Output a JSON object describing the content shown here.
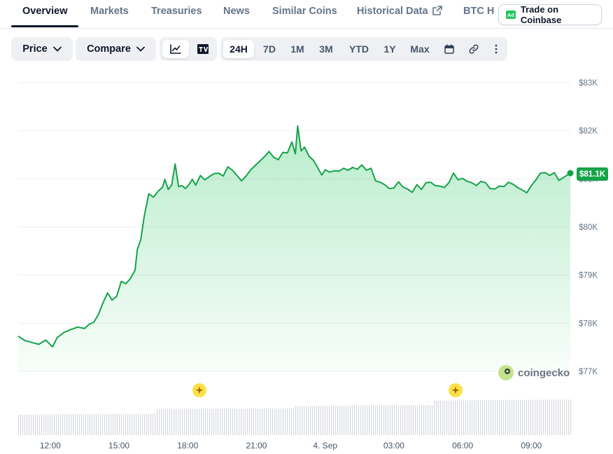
{
  "tabs": [
    {
      "label": "Overview",
      "active": true
    },
    {
      "label": "Markets"
    },
    {
      "label": "Treasuries"
    },
    {
      "label": "News"
    },
    {
      "label": "Similar Coins"
    },
    {
      "label": "Historical Data"
    },
    {
      "label": "BTC H"
    }
  ],
  "trade_button": {
    "badge": "Ad",
    "label": "Trade on Coinbase"
  },
  "toolbar": {
    "price_dropdown": "Price",
    "compare_dropdown": "Compare",
    "chart_modes": [
      "line-chart-icon",
      "tradingview-icon"
    ],
    "ranges": [
      "24H",
      "7D",
      "1M",
      "3M",
      "YTD",
      "1Y",
      "Max"
    ],
    "active_range": "24H",
    "tools": [
      "calendar-icon",
      "link-icon",
      "more-icon"
    ]
  },
  "price_badge": "$81.1K",
  "watermark": "coingecko",
  "colors": {
    "line": "#16a34a",
    "fill": "#22c55e",
    "volume": "#d1d5db",
    "marker": "#fde047"
  },
  "chart_data": {
    "type": "area",
    "y_ticks": [
      "$83K",
      "$82K",
      "$81K",
      "$80K",
      "$79K",
      "$78K",
      "$77K"
    ],
    "ylim": [
      77000,
      83000
    ],
    "x_ticks": [
      "12:00",
      "15:00",
      "18:00",
      "21:00",
      "4. Sep",
      "03:00",
      "06:00",
      "09:00"
    ],
    "x_range_hours": [
      -1.4,
      22.7
    ],
    "grid": true,
    "series": [
      {
        "values": [
          [
            -1.4,
            77730
          ],
          [
            -1.1,
            77640
          ],
          [
            -0.8,
            77600
          ],
          [
            -0.5,
            77560
          ],
          [
            -0.2,
            77650
          ],
          [
            0.1,
            77510
          ],
          [
            0.3,
            77700
          ],
          [
            0.6,
            77810
          ],
          [
            0.9,
            77870
          ],
          [
            1.2,
            77920
          ],
          [
            1.5,
            77890
          ],
          [
            1.7,
            77980
          ],
          [
            1.9,
            78020
          ],
          [
            2.1,
            78180
          ],
          [
            2.3,
            78420
          ],
          [
            2.5,
            78630
          ],
          [
            2.7,
            78480
          ],
          [
            2.9,
            78560
          ],
          [
            3.1,
            78870
          ],
          [
            3.3,
            78820
          ],
          [
            3.5,
            78930
          ],
          [
            3.7,
            79100
          ],
          [
            3.8,
            79530
          ],
          [
            3.95,
            79740
          ],
          [
            4.1,
            80220
          ],
          [
            4.3,
            80690
          ],
          [
            4.5,
            80620
          ],
          [
            4.7,
            80740
          ],
          [
            4.9,
            80830
          ],
          [
            5.0,
            80990
          ],
          [
            5.15,
            80780
          ],
          [
            5.3,
            80870
          ],
          [
            5.45,
            81310
          ],
          [
            5.6,
            80840
          ],
          [
            5.75,
            80860
          ],
          [
            5.9,
            80800
          ],
          [
            6.05,
            80880
          ],
          [
            6.2,
            80990
          ],
          [
            6.35,
            80870
          ],
          [
            6.55,
            81070
          ],
          [
            6.75,
            80980
          ],
          [
            6.95,
            81050
          ],
          [
            7.15,
            81110
          ],
          [
            7.35,
            81120
          ],
          [
            7.55,
            81060
          ],
          [
            7.75,
            81250
          ],
          [
            7.95,
            81180
          ],
          [
            8.15,
            81070
          ],
          [
            8.35,
            80960
          ],
          [
            8.55,
            81060
          ],
          [
            8.75,
            81190
          ],
          [
            8.95,
            81280
          ],
          [
            9.15,
            81370
          ],
          [
            9.35,
            81460
          ],
          [
            9.55,
            81570
          ],
          [
            9.75,
            81450
          ],
          [
            9.95,
            81400
          ],
          [
            10.15,
            81550
          ],
          [
            10.35,
            81540
          ],
          [
            10.55,
            81770
          ],
          [
            10.7,
            81520
          ],
          [
            10.8,
            82100
          ],
          [
            10.95,
            81580
          ],
          [
            11.1,
            81660
          ],
          [
            11.3,
            81470
          ],
          [
            11.5,
            81380
          ],
          [
            11.7,
            81210
          ],
          [
            11.85,
            81080
          ],
          [
            12.0,
            81190
          ],
          [
            12.2,
            81140
          ],
          [
            12.4,
            81170
          ],
          [
            12.6,
            81160
          ],
          [
            12.8,
            81220
          ],
          [
            13.0,
            81180
          ],
          [
            13.2,
            81240
          ],
          [
            13.4,
            81200
          ],
          [
            13.6,
            81290
          ],
          [
            13.8,
            81180
          ],
          [
            14.0,
            81220
          ],
          [
            14.2,
            80960
          ],
          [
            14.4,
            80930
          ],
          [
            14.6,
            80880
          ],
          [
            14.8,
            80800
          ],
          [
            15.0,
            80810
          ],
          [
            15.2,
            80940
          ],
          [
            15.4,
            80830
          ],
          [
            15.6,
            80790
          ],
          [
            15.8,
            80720
          ],
          [
            16.0,
            80880
          ],
          [
            16.2,
            80780
          ],
          [
            16.4,
            80920
          ],
          [
            16.6,
            80930
          ],
          [
            16.8,
            80860
          ],
          [
            17.0,
            80850
          ],
          [
            17.2,
            80820
          ],
          [
            17.4,
            80920
          ],
          [
            17.6,
            81120
          ],
          [
            17.8,
            80980
          ],
          [
            18.0,
            81010
          ],
          [
            18.2,
            80950
          ],
          [
            18.4,
            80920
          ],
          [
            18.6,
            80860
          ],
          [
            18.8,
            80950
          ],
          [
            19.0,
            80920
          ],
          [
            19.2,
            80800
          ],
          [
            19.4,
            80790
          ],
          [
            19.6,
            80850
          ],
          [
            19.8,
            80840
          ],
          [
            20.0,
            80930
          ],
          [
            20.2,
            80890
          ],
          [
            20.4,
            80820
          ],
          [
            20.6,
            80770
          ],
          [
            20.8,
            80710
          ],
          [
            21.0,
            80860
          ],
          [
            21.2,
            80980
          ],
          [
            21.4,
            81120
          ],
          [
            21.6,
            81130
          ],
          [
            21.8,
            81070
          ],
          [
            22.0,
            81130
          ],
          [
            22.2,
            80970
          ],
          [
            22.4,
            81030
          ],
          [
            22.7,
            81120
          ]
        ]
      }
    ],
    "volume_level": [
      0.45,
      0.55,
      0.6,
      0.7
    ],
    "event_markers_hours": [
      6.5,
      17.7
    ]
  }
}
